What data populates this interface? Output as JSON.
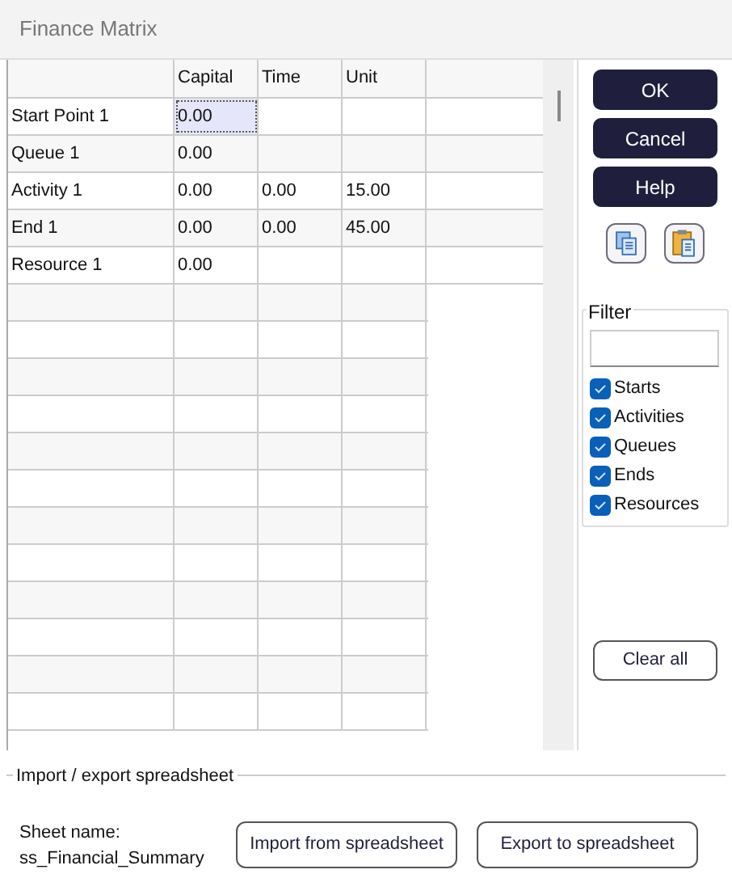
{
  "window": {
    "title": "Finance Matrix"
  },
  "table": {
    "columns": [
      "Capital",
      "Time",
      "Unit"
    ],
    "rows": [
      {
        "name": "Start Point 1",
        "cells": [
          {
            "value": "0.00",
            "selected": true
          },
          {
            "selected": false
          },
          {
            "selected": false
          }
        ]
      },
      {
        "name": "Queue 1",
        "cells": [
          {
            "value": "0.00",
            "selected": false
          },
          {
            "selected": false
          },
          {
            "selected": false
          }
        ]
      },
      {
        "name": "Activity 1",
        "cells": [
          {
            "value": "0.00",
            "selected": false
          },
          {
            "value": "0.00",
            "selected": false
          },
          {
            "value": "15.00",
            "selected": false
          }
        ]
      },
      {
        "name": "End 1",
        "cells": [
          {
            "value": "0.00",
            "selected": false
          },
          {
            "value": "0.00",
            "selected": false
          },
          {
            "value": "45.00",
            "selected": false
          }
        ]
      },
      {
        "name": "Resource 1",
        "cells": [
          {
            "value": "0.00",
            "selected": false
          },
          {
            "selected": false
          },
          {
            "selected": false
          }
        ]
      }
    ]
  },
  "buttons": [
    "OK",
    "Cancel",
    "Help"
  ],
  "filter": {
    "label": "Filter",
    "items": [
      {
        "label": "Starts",
        "checked": true
      },
      {
        "label": "Activities",
        "checked": true
      },
      {
        "label": "Queues",
        "checked": true
      },
      {
        "label": "Ends",
        "checked": true
      },
      {
        "label": "Resources",
        "checked": true
      }
    ],
    "clear_button": "Clear all"
  },
  "spreadsheet": {
    "label": "Import / export spreadsheet",
    "sheet_label": "Sheet name:",
    "sheet_name": "ss_Financial_Summary",
    "import_button": "Import from spreadsheet",
    "export_button": "Export to spreadsheet"
  }
}
